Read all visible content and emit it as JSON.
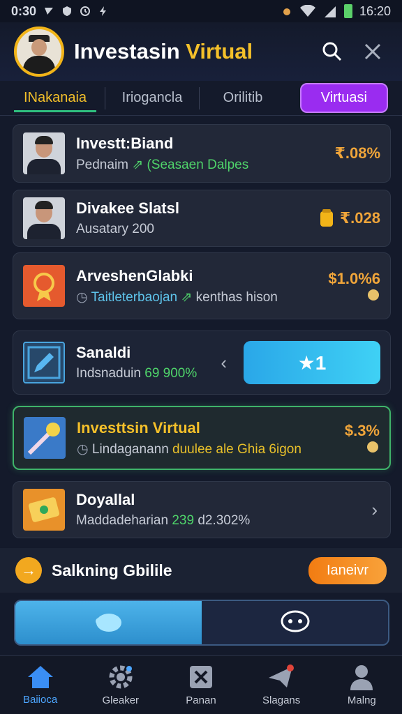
{
  "status_bar": {
    "left_text": "0:30",
    "time": "16:20"
  },
  "header": {
    "title_main": "Investasin ",
    "title_accent": "Virtual"
  },
  "tabs": [
    {
      "label": "INakanaia",
      "active": true
    },
    {
      "label": "Iriogancla",
      "active": false
    },
    {
      "label": "Orilitib",
      "active": false
    }
  ],
  "tab_pill": "Virtuasi",
  "cards": [
    {
      "title": "Investt:Biand",
      "sub_text": "Pednaim",
      "sub_green": "(Seasaen Dalpes",
      "pct": "₹.08%"
    },
    {
      "title": "Divakee Slatsl",
      "sub_text": "Ausatary 200",
      "pct": "₹.028"
    },
    {
      "title": "ArveshenGlabki",
      "sub_text": "Taitleterbaojan",
      "sub_green": "kenthas hison",
      "pct": "$1.0%6"
    },
    {
      "title": "Sanaldi",
      "sub_text": "Indsnaduin",
      "sub_green": "69 900%",
      "btn_label": "★1"
    },
    {
      "title": "Investtsin Virtual",
      "sub_text": "Lindaganann",
      "sub_green": "duulee ale Ghia 6igon",
      "pct": "$.3%"
    },
    {
      "title": "Doyallal",
      "sub_text": "Maddadeharian",
      "sub_green": "239",
      "sub_tail": "d2.302%"
    }
  ],
  "section": {
    "title": "Salkning Gbilile",
    "button": "Ianeivr"
  },
  "bottom_nav": [
    {
      "label": "Baiioca",
      "icon": "home-icon",
      "active": true
    },
    {
      "label": "Gleaker",
      "icon": "gear-icon",
      "active": false
    },
    {
      "label": "Panan",
      "icon": "close-box-icon",
      "active": false
    },
    {
      "label": "Slagans",
      "icon": "send-icon",
      "active": false
    },
    {
      "label": "Malng",
      "icon": "user-icon",
      "active": false
    }
  ],
  "colors": {
    "accent_gold": "#f4c02a",
    "accent_purple": "#9a2cf0",
    "accent_green": "#4fd46a",
    "accent_blue": "#4da6ff"
  }
}
